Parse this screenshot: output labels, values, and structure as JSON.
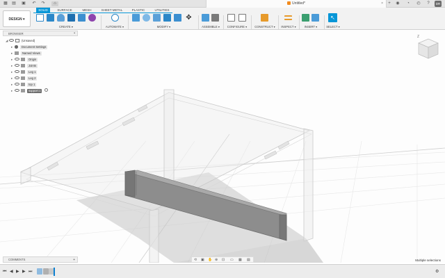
{
  "title_bar": {
    "document_title": "Untitled*",
    "user_initials": "DR"
  },
  "toolbar": {
    "workspace_button": "DESIGN ▾",
    "tabs": [
      {
        "label": "SOLID",
        "active": true
      },
      {
        "label": "SURFACE",
        "active": false
      },
      {
        "label": "MESH",
        "active": false
      },
      {
        "label": "SHEET METAL",
        "active": false
      },
      {
        "label": "PLASTIC",
        "active": false
      },
      {
        "label": "UTILITIES",
        "active": false
      }
    ],
    "groups": [
      {
        "label": "CREATE ▾"
      },
      {
        "label": "AUTOMATE ▾"
      },
      {
        "label": "MODIFY ▾"
      },
      {
        "label": "ASSEMBLE ▾"
      },
      {
        "label": "CONFIGURE ▾"
      },
      {
        "label": "CONSTRUCT ▾"
      },
      {
        "label": "INSPECT ▾"
      },
      {
        "label": "INSERT ▾"
      },
      {
        "label": "SELECT ▾"
      }
    ],
    "accent_color": "#0696d7"
  },
  "browser": {
    "header": "BROWSER",
    "items": [
      {
        "label": "(Unsaved)",
        "indent": 0,
        "selected": false
      },
      {
        "label": "Document Settings",
        "indent": 1,
        "selected": false
      },
      {
        "label": "Named Views",
        "indent": 1,
        "selected": false
      },
      {
        "label": "Origin",
        "indent": 1,
        "selected": false
      },
      {
        "label": "Joints",
        "indent": 1,
        "selected": false
      },
      {
        "label": "Leg 1",
        "indent": 1,
        "selected": false
      },
      {
        "label": "Leg 2",
        "indent": 1,
        "selected": false
      },
      {
        "label": "top 1",
        "indent": 1,
        "selected": false
      },
      {
        "label": "support:1",
        "indent": 1,
        "selected": true
      }
    ]
  },
  "viewcube": {
    "axis_label": "Z"
  },
  "bottom": {
    "comments_label": "COMMENTS",
    "status_text": "Multiple selections"
  }
}
